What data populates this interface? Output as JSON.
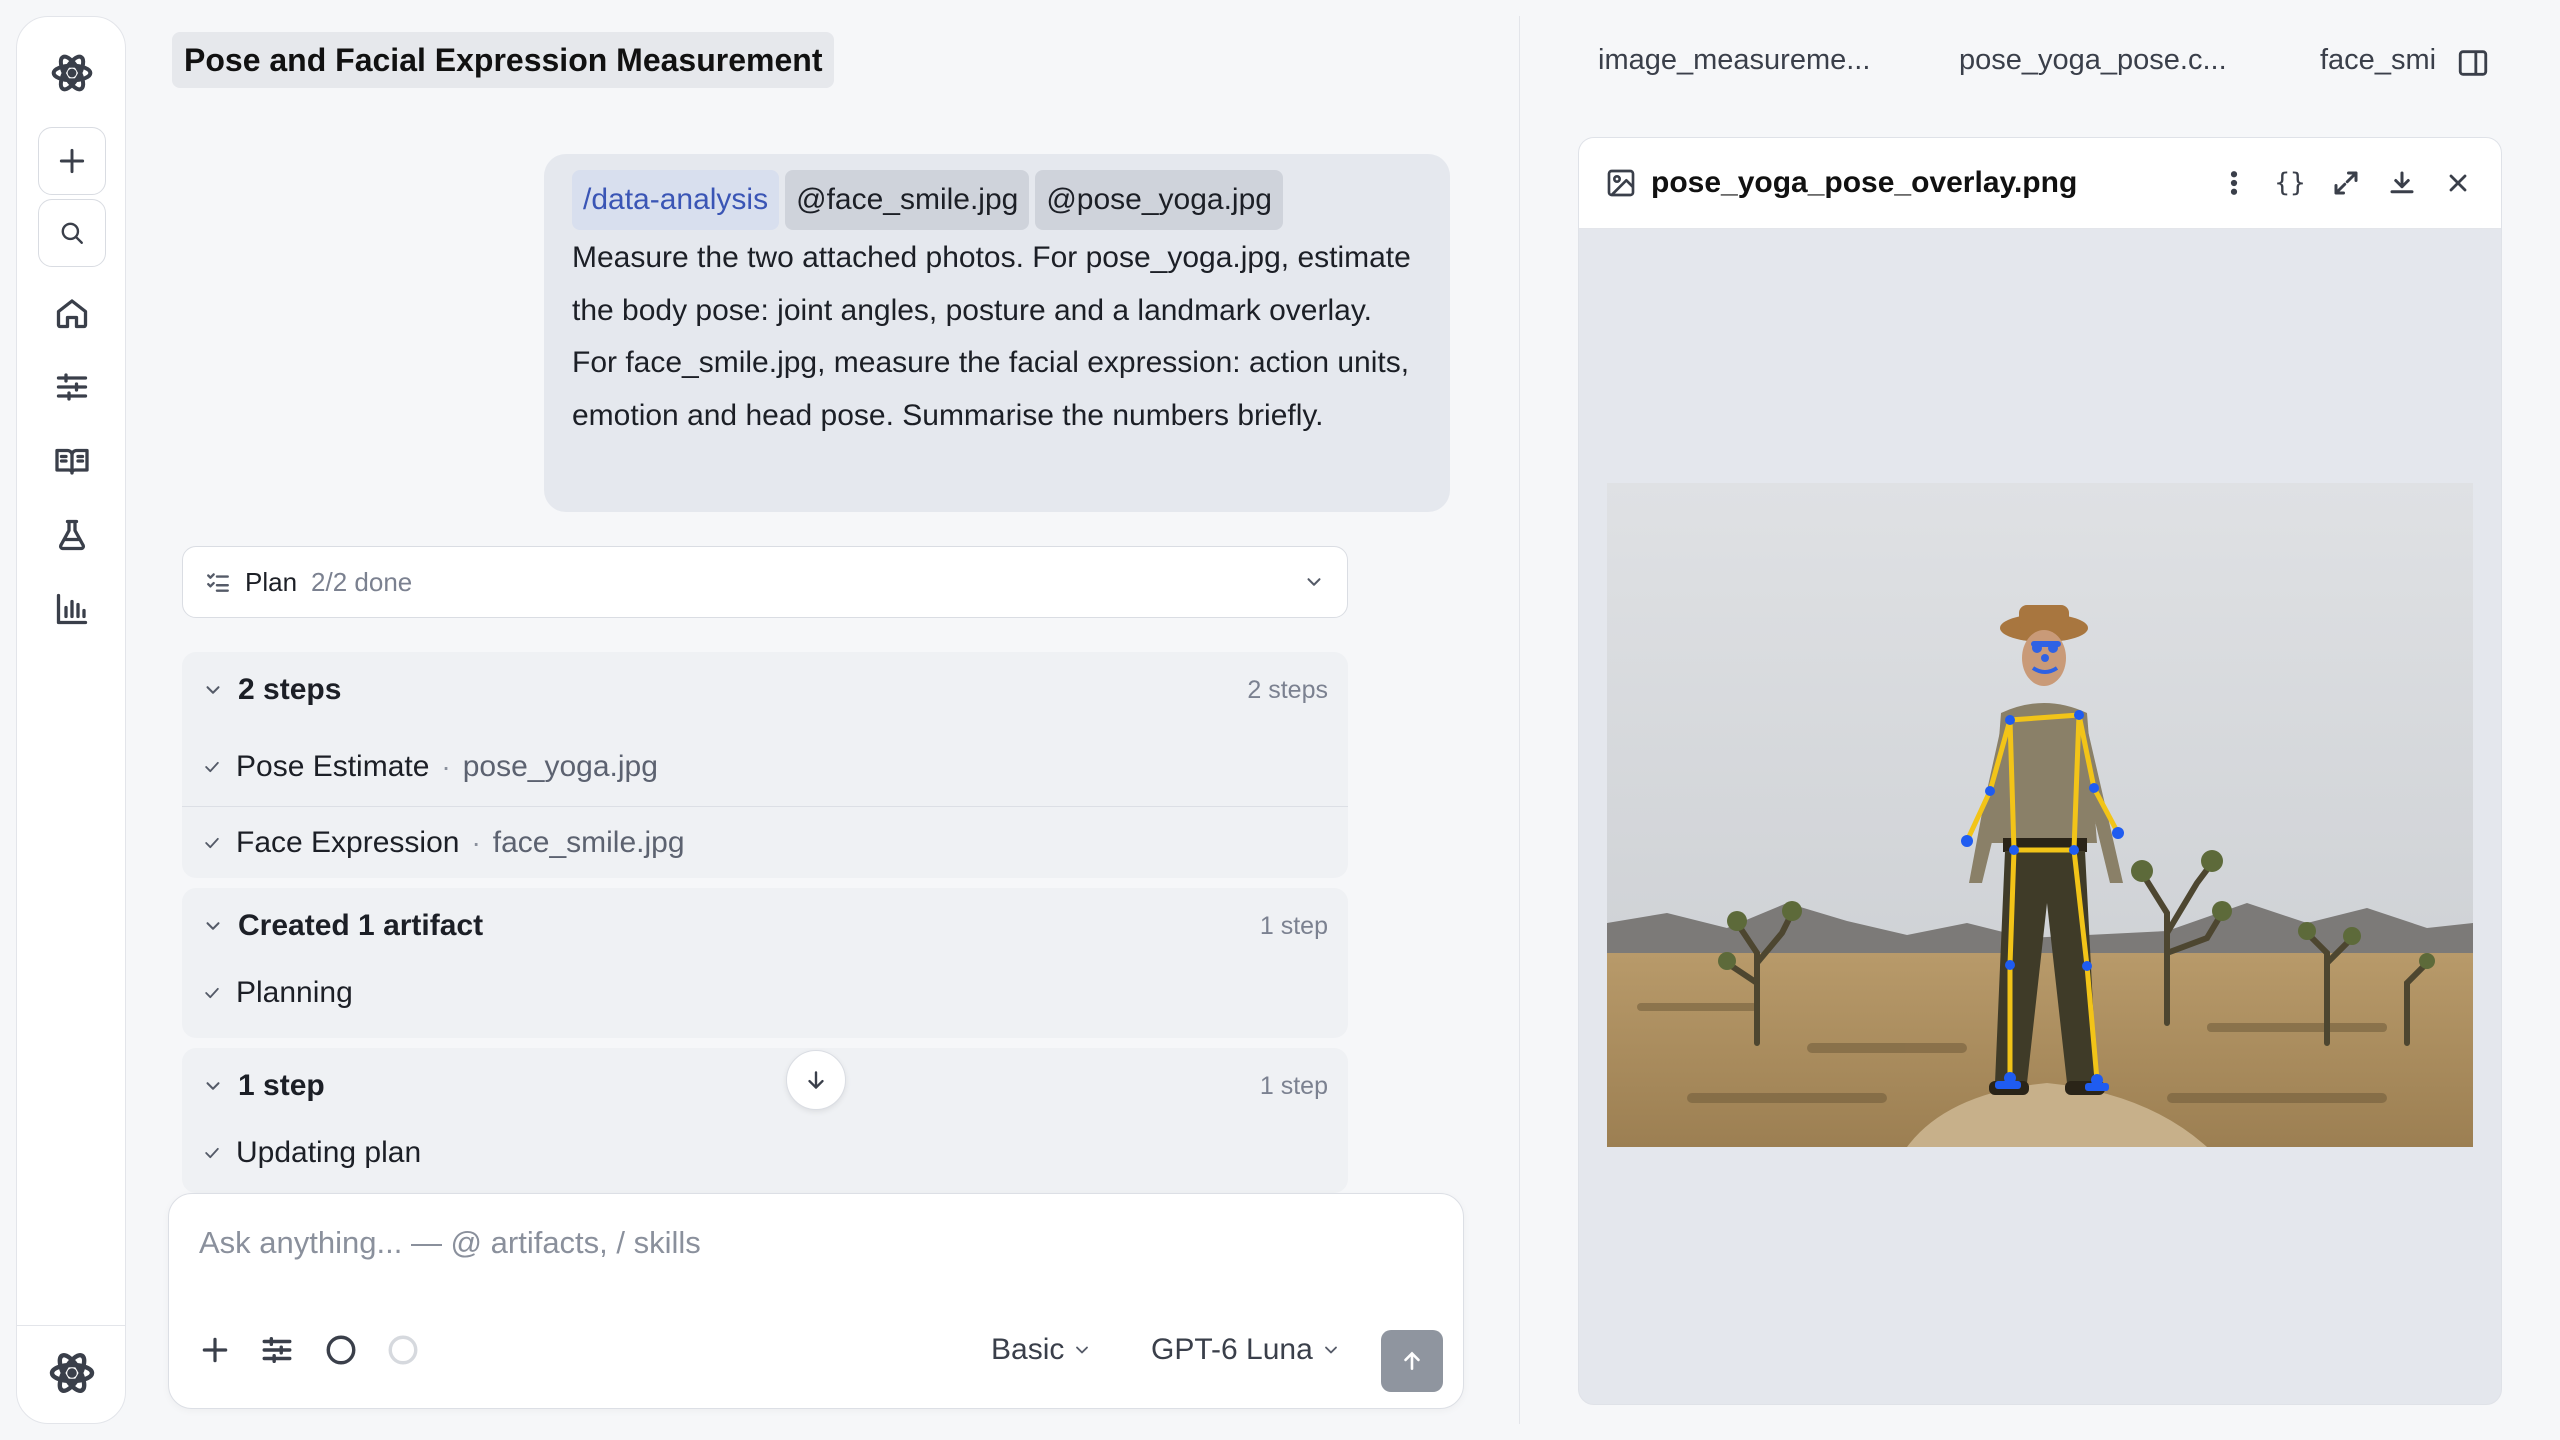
{
  "sidebar": {
    "items": [
      {
        "icon": "atom-logo-icon"
      },
      {
        "icon": "plus-icon",
        "label": "New"
      },
      {
        "icon": "search-icon",
        "label": "Search"
      },
      {
        "icon": "home-icon",
        "label": "Home"
      },
      {
        "icon": "sliders-icon",
        "label": "Settings"
      },
      {
        "icon": "book-icon",
        "label": "Library"
      },
      {
        "icon": "flask-icon",
        "label": "Lab"
      },
      {
        "icon": "bar-chart-icon",
        "label": "Analytics"
      }
    ]
  },
  "chat": {
    "title": "Pose and Facial Expression Measurement",
    "user_message": {
      "skill_chip": "/data-analysis",
      "file_chips": [
        "@face_smile.jpg",
        "@pose_yoga.jpg"
      ],
      "text": "Measure the two attached photos. For pose_yoga.jpg, estimate the body pose: joint angles, posture and a landmark overlay. For face_smile.jpg, measure the facial expression: action units, emotion and head pose. Summarise the numbers briefly."
    },
    "plan": {
      "label": "Plan",
      "status": "2/2 done"
    },
    "groups": [
      {
        "title": "2 steps",
        "count": "2 steps",
        "steps": [
          {
            "name": "Pose Estimate",
            "file": "pose_yoga.jpg"
          },
          {
            "name": "Face Expression",
            "file": "face_smile.jpg"
          }
        ]
      },
      {
        "title": "Created 1 artifact",
        "count": "1 step",
        "steps": [
          {
            "name": "Planning"
          }
        ]
      },
      {
        "title": "1 step",
        "count": "1 step",
        "steps": [
          {
            "name": "Updating plan"
          }
        ]
      }
    ]
  },
  "composer": {
    "placeholder": "Ask anything... — @ artifacts, / skills",
    "mode": "Basic",
    "model": "GPT-6 Luna"
  },
  "artifacts": {
    "tabs": [
      "image_measureme...",
      "pose_yoga_pose.c...",
      "face_smi"
    ],
    "viewer": {
      "filename": "pose_yoga_pose_overlay.png",
      "json_label": "{}"
    }
  },
  "colors": {
    "skill_chip_text": "#3a55b5",
    "pose_skeleton": "#f2c418",
    "pose_landmarks": "#1f5cf0"
  }
}
